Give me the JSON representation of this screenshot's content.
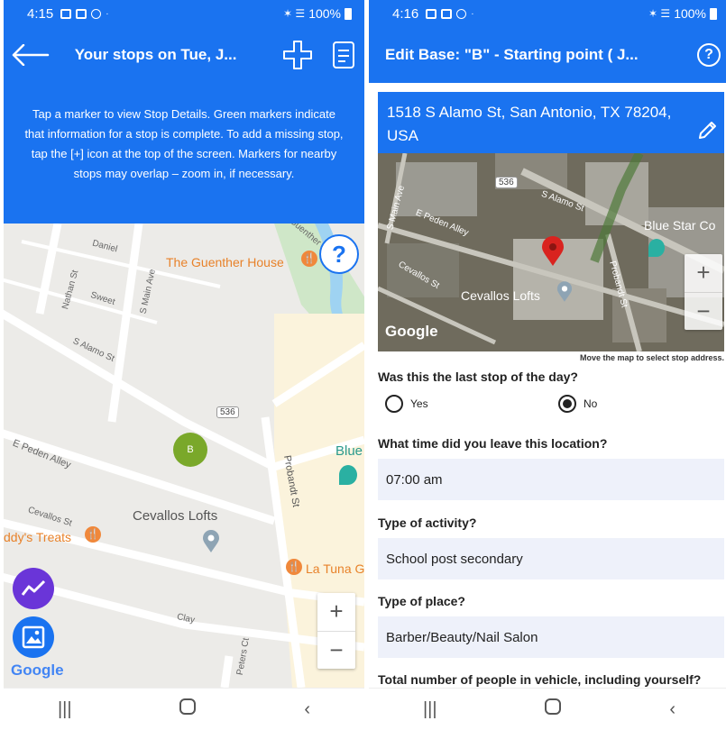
{
  "status_bar": {
    "left_time": "4:15",
    "right_time": "4:16",
    "battery": "100%"
  },
  "left_screen": {
    "title": "Your stops on Tue, J...",
    "info_text": "Tap a marker to view Stop Details. Green markers indicate that information for a stop is complete. To add a missing stop, tap the [+] icon at the top of the screen. Markers for nearby stops may overlap – zoom in, if necessary.",
    "help_glyph": "?",
    "map": {
      "streets": [
        "Daniel",
        "Nathan St",
        "Sweet",
        "S Main Ave",
        "S Alamo St",
        "E Peden Alley",
        "Cevallos St",
        "Clay",
        "Peters Ct",
        "Probandt St",
        "Guenther St"
      ],
      "route_shield": "536",
      "pois": [
        "The Guenther House",
        "Cevallos Lofts",
        "ddy's Treats",
        "La Tuna G",
        "Blue"
      ],
      "marker_label": "B",
      "marker_color": "#7aa82a",
      "google": "Google",
      "zoom_in": "+",
      "zoom_out": "−"
    }
  },
  "right_screen": {
    "title": "Edit Base: \"B\" - Starting point ( J...",
    "help_glyph": "?",
    "address": "1518 S Alamo St, San Antonio, TX 78204, USA",
    "map_hint": "Move the map to select stop address.",
    "sat_map": {
      "labels": [
        "S Alamo St",
        "Cevallos Lofts",
        "Blue Star Co",
        "E Peden Alley",
        "Cevallos St",
        "Probandt St",
        "S Main Ave"
      ],
      "route_shield": "536",
      "google": "Google",
      "zoom_in": "+",
      "zoom_out": "−"
    },
    "q_last_stop": "Was this the last stop of the day?",
    "opt_yes": "Yes",
    "opt_no": "No",
    "selected_option": "No",
    "q_leave_time": "What time did you leave this location?",
    "leave_time": "07:00 am",
    "q_activity": "Type of activity?",
    "activity": "School post secondary",
    "q_place": "Type of place?",
    "place": "Barber/Beauty/Nail Salon",
    "q_cut": "Total number of people in vehicle, including yourself?"
  },
  "colors": {
    "accent": "#1a73f0",
    "field_bg": "#eef1fa",
    "marker_red": "#d9231f"
  }
}
